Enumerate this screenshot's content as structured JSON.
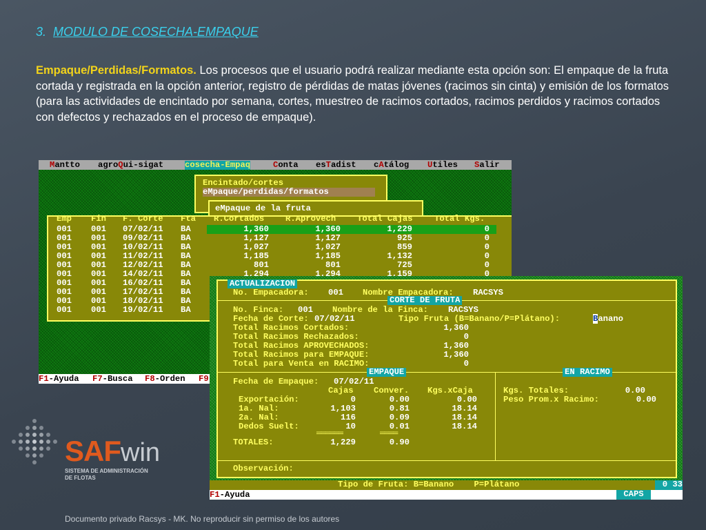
{
  "heading": {
    "number": "3.",
    "title": "MODULO DE COSECHA-EMPAQUE"
  },
  "paragraph": {
    "bold": "Empaque/Perdidas/Formatos.",
    "text": " Los procesos que el usuario podrá realizar mediante esta opción son: El empaque de la fruta cortada y registrada en la opción anterior, registro de pérdidas de matas jóvenes (racimos sin cinta) y emisión de los formatos (para las actividades de encintado por semana, cortes, muestreo de racimos cortados, racimos perdidos y racimos cortados con defectos  y rechazados en el proceso de empaque)."
  },
  "screen1": {
    "menu": [
      {
        "pre": "",
        "hot": "M",
        "post": "antto"
      },
      {
        "pre": "agro",
        "hot": "Q",
        "post": "ui-sigat"
      },
      {
        "pre": "",
        "hot": "",
        "post": "cosecha-Empaq",
        "selected": true
      },
      {
        "pre": "",
        "hot": "C",
        "post": "onta"
      },
      {
        "pre": "es",
        "hot": "T",
        "post": "adist"
      },
      {
        "pre": "c",
        "hot": "A",
        "post": "tálog"
      },
      {
        "pre": "",
        "hot": "U",
        "post": "tiles"
      },
      {
        "pre": "",
        "hot": "S",
        "post": "alir"
      }
    ],
    "submenu": [
      "Encintado/cortes",
      "eMpaque/perdidas/formatos"
    ],
    "submenu2": "eMpaque de la fruta",
    "columns": [
      "Emp",
      "Fin",
      "F. Corte",
      "Fta",
      "R.Cortados",
      "R.Aprovech",
      "Total Cajas",
      "Total Kgs."
    ],
    "rows": [
      [
        "001",
        "001",
        "07/02/11",
        "BA",
        "1,360",
        "1,360",
        "1,229",
        "0"
      ],
      [
        "001",
        "001",
        "09/02/11",
        "BA",
        "1,127",
        "1,127",
        "925",
        "0"
      ],
      [
        "001",
        "001",
        "10/02/11",
        "BA",
        "1,027",
        "1,027",
        "859",
        "0"
      ],
      [
        "001",
        "001",
        "11/02/11",
        "BA",
        "1,185",
        "1,185",
        "1,132",
        "0"
      ],
      [
        "001",
        "001",
        "12/02/11",
        "BA",
        "801",
        "801",
        "725",
        "0"
      ],
      [
        "001",
        "001",
        "14/02/11",
        "BA",
        "1,294",
        "1,294",
        "1,159",
        "0"
      ],
      [
        "001",
        "001",
        "16/02/11",
        "BA",
        "",
        "",
        "",
        ""
      ],
      [
        "001",
        "001",
        "17/02/11",
        "BA",
        "",
        "",
        "",
        ""
      ],
      [
        "001",
        "001",
        "18/02/11",
        "BA",
        "",
        "",
        "",
        ""
      ],
      [
        "001",
        "001",
        "19/02/11",
        "BA",
        "",
        "",
        "",
        ""
      ]
    ],
    "fkeys": [
      {
        "k": "F1",
        "l": "-Ayuda"
      },
      {
        "k": "F7",
        "l": "-Busca"
      },
      {
        "k": "F8",
        "l": "-Orden"
      },
      {
        "k": "F9",
        "l": ""
      }
    ]
  },
  "screen2": {
    "actualizacion": "ACTUALIZACION",
    "empacadora_label": "No. Empacadora:",
    "empacadora_val": "001",
    "nombre_emp_label": "Nombre Empacadora:",
    "nombre_emp_val": "RACSYS",
    "corte_tag": "CORTE DE FRUTA",
    "finca_label": "No. Finca:",
    "finca_val": "001",
    "nombre_finca_label": "Nombre de la Finca:",
    "nombre_finca_val": "RACSYS",
    "fecha_corte_label": "Fecha de Corte:",
    "fecha_corte_val": "07/02/11",
    "tipo_fruta_label": "Tipo Fruta (B=Banano/P=Plátano):",
    "tipo_fruta_hl": "B",
    "tipo_fruta_rest": "anano",
    "totals": [
      {
        "label": "Total Racimos Cortados:",
        "value": "1,360"
      },
      {
        "label": "Total Racimos Rechazados:",
        "value": "0"
      },
      {
        "label": "Total Racimos APROVECHADOS:",
        "value": "1,360"
      },
      {
        "label": "Total Racimos para EMPAQUE:",
        "value": "1,360"
      },
      {
        "label": "Total para Venta en RACIMO:",
        "value": "0"
      }
    ],
    "empaque_tag": "EMPAQUE",
    "racimo_tag": "EN RACIMO",
    "fecha_empaque_label": "Fecha de Empaque:",
    "fecha_empaque_val": "07/02/11",
    "emp_cols": [
      "Cajas",
      "Conver.",
      "Kgs.xCaja"
    ],
    "emp_rows": [
      {
        "label": "Exportación:",
        "cajas": "0",
        "conver": "0.00",
        "kgs": "0.00"
      },
      {
        "label": "1a. Nal:",
        "cajas": "1,103",
        "conver": "0.81",
        "kgs": "18.14"
      },
      {
        "label": "2a. Nal:",
        "cajas": "116",
        "conver": "0.09",
        "kgs": "18.14"
      },
      {
        "label": "Dedos Suelt:",
        "cajas": "10",
        "conver": "0.01",
        "kgs": "18.14"
      }
    ],
    "totales_label": "TOTALES:",
    "totales_cajas": "1,229",
    "totales_conver": "0.90",
    "kgs_totales_label": "Kgs. Totales:",
    "kgs_totales_val": "0.00",
    "peso_prom_label": "Peso Prom.x Racimo:",
    "peso_prom_val": "0.00",
    "observacion_label": "Observación:",
    "tipo_hint": "Tipo de Fruta: B=Banano    P=Plátano",
    "status_right": "0 33",
    "fkey": "F1",
    "fkey_label": "-Ayuda",
    "caps": "CAPS"
  },
  "logo": {
    "saf": "SAF",
    "win": "win",
    "line1": "SISTEMA DE ADMINISTRACIÓN",
    "line2": "DE FLOTAS"
  },
  "footer": "Documento privado Racsys - MK. No reproducir sin permiso de los autores"
}
